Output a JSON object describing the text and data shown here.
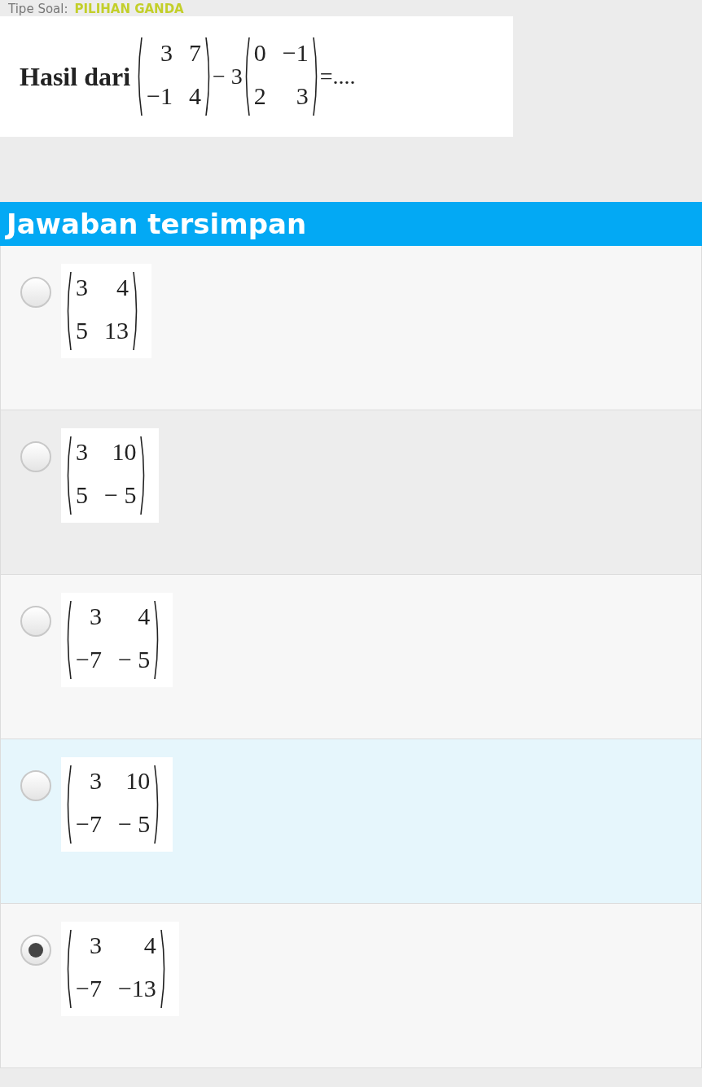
{
  "question_type": {
    "label": "Tipe Soal:",
    "value": "PILIHAN GANDA"
  },
  "question": {
    "terms": [
      {
        "kind": "text",
        "text": "Hasil dari"
      },
      {
        "kind": "matrix",
        "rows": [
          [
            "3",
            "7"
          ],
          [
            "−1",
            "4"
          ]
        ]
      },
      {
        "kind": "text",
        "text": "− 3"
      },
      {
        "kind": "matrix",
        "rows": [
          [
            "0",
            "−1"
          ],
          [
            "2",
            "3"
          ]
        ]
      },
      {
        "kind": "text",
        "text": "=...."
      }
    ]
  },
  "answers_header": "Jawaban tersimpan",
  "options": [
    {
      "kind": "plain",
      "selected": false,
      "rows": [
        [
          "3",
          "4"
        ],
        [
          "5",
          "13"
        ]
      ]
    },
    {
      "kind": "shaded",
      "selected": false,
      "rows": [
        [
          "3",
          "10"
        ],
        [
          "5",
          "− 5"
        ]
      ]
    },
    {
      "kind": "plain",
      "selected": false,
      "rows": [
        [
          "3",
          "4"
        ],
        [
          "−7",
          "− 5"
        ]
      ]
    },
    {
      "kind": "highlighted",
      "selected": false,
      "rows": [
        [
          "3",
          "10"
        ],
        [
          "−7",
          "− 5"
        ]
      ]
    },
    {
      "kind": "plain",
      "selected": true,
      "rows": [
        [
          "3",
          "4"
        ],
        [
          "−7",
          "−13"
        ]
      ]
    }
  ]
}
